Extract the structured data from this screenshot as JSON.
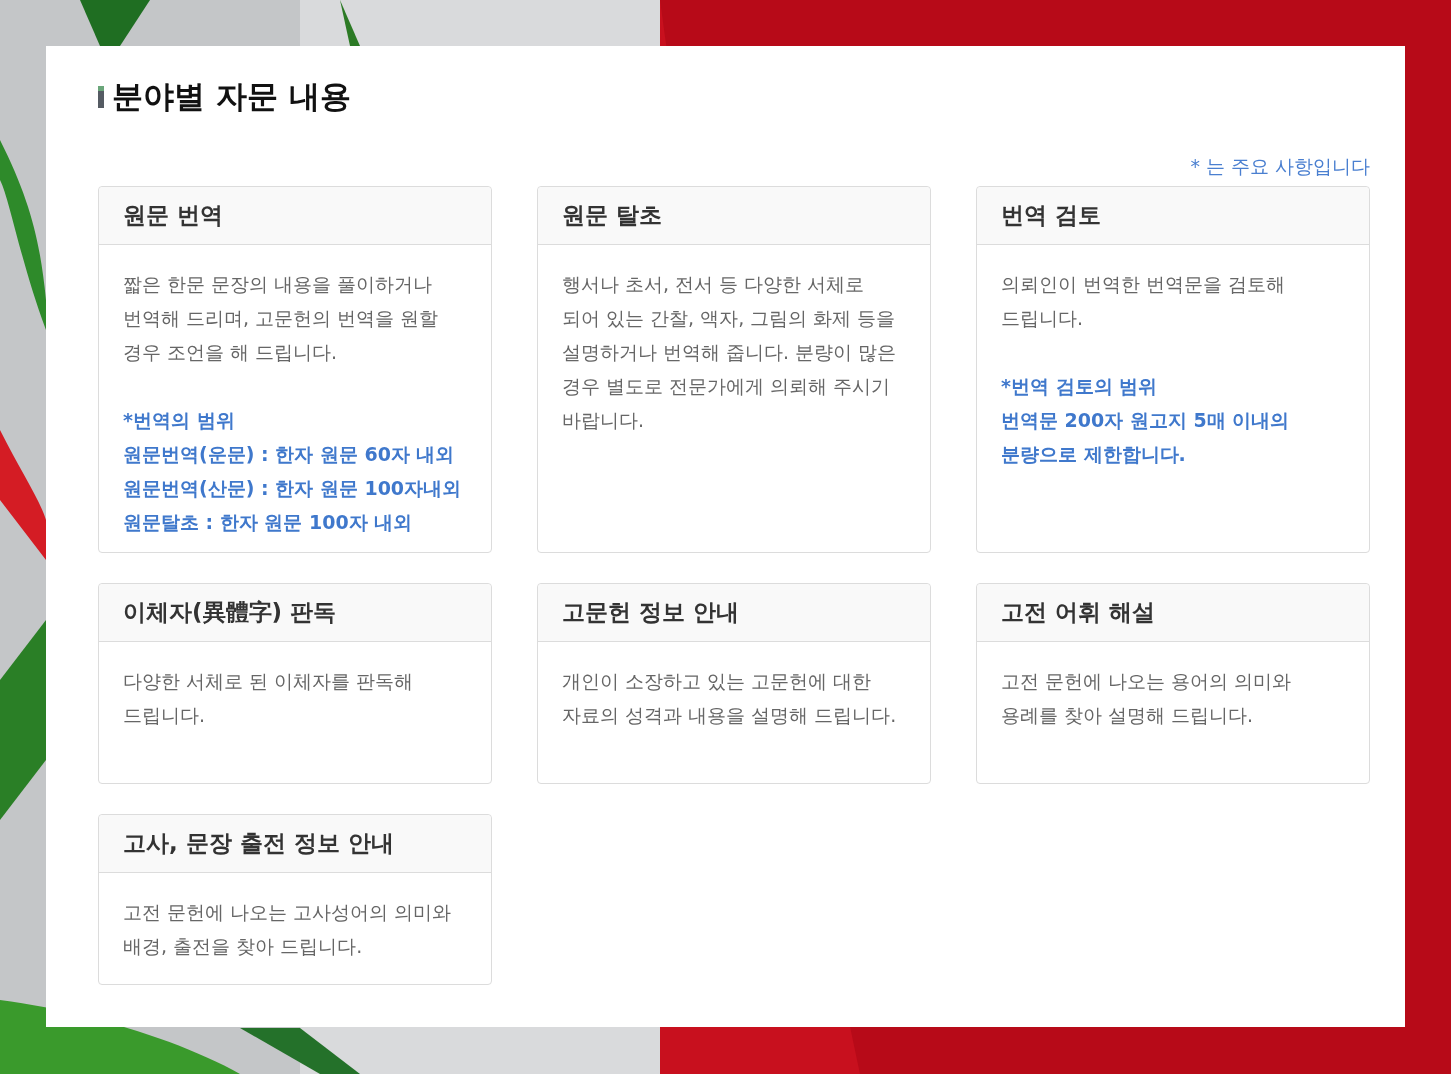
{
  "heading": "분야별 자문 내용",
  "legend": "* 는 주요 사항입니다",
  "services": [
    {
      "title": "원문 번역",
      "description": "짧은 한문 문장의 내용을 풀이하거나 번역해 드리며, 고문헌의 번역을 원할 경우 조언을 해 드립니다.",
      "notes": [
        "*번역의 범위",
        "원문번역(운문) : 한자 원문 60자 내외",
        "원문번역(산문) : 한자 원문 100자내외",
        "원문탈초 : 한자 원문 100자 내외"
      ]
    },
    {
      "title": "원문 탈초",
      "description": "행서나 초서, 전서 등 다양한 서체로 되어 있는 간찰, 액자, 그림의 화제 등을 설명하거나 번역해 줍니다. 분량이 많은 경우 별도로 전문가에게 의뢰해 주시기 바랍니다."
    },
    {
      "title": "번역 검토",
      "description": "의뢰인이 번역한 번역문을 검토해 드립니다.",
      "notes": [
        "*번역 검토의 범위",
        "번역문 200자 원고지 5매 이내의 분량으로 제한합니다."
      ]
    },
    {
      "title": "이체자(異體字) 판독",
      "description": "다양한 서체로 된 이체자를 판독해 드립니다."
    },
    {
      "title": "고문헌 정보 안내",
      "description": "개인이 소장하고 있는 고문헌에 대한 자료의 성격과 내용을 설명해 드립니다."
    },
    {
      "title": "고전 어휘 해설",
      "description": "고전 문헌에 나오는 용어의 의미와 용례를 찾아 설명해 드립니다."
    },
    {
      "title": "고사, 문장 출전 정보 안내",
      "description": "고전 문헌에 나오는 고사성어의 의미와 배경, 출전을 찾아 드립니다."
    }
  ]
}
